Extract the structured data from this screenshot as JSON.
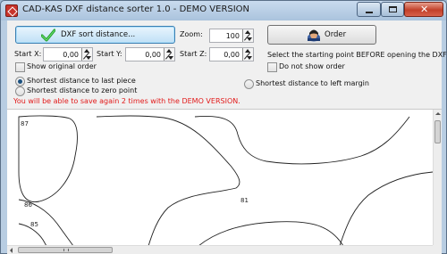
{
  "window": {
    "title": "CAD-KAS DXF distance sorter 1.0 - DEMO VERSION",
    "close_glyph": "✕"
  },
  "toolbar": {
    "sort_button_label": "DXF sort distance...",
    "zoom_label": "Zoom:",
    "zoom_value": "100",
    "order_button_label": "Order",
    "instruction_text": "Select the starting point BEFORE opening the DXF file!"
  },
  "start_fields": {
    "start_x_label": "Start X:",
    "start_x_value": "0,00",
    "start_y_label": "Start Y:",
    "start_y_value": "0,00",
    "start_z_label": "Start Z:",
    "start_z_value": "0,00"
  },
  "options": {
    "show_original_order": "Show original order",
    "do_not_show_order": "Do not show order",
    "radio_last_piece": "Shortest distance to last piece",
    "radio_zero_point": "Shortest distance to zero point",
    "radio_left_margin": "Shortest distance to left margin",
    "selected_radio": "Shortest distance to last piece"
  },
  "demo_note": "You will be able to save again 2 times with the DEMO VERSION.",
  "drawing": {
    "piece_labels": [
      "87",
      "86",
      "85",
      "81"
    ]
  },
  "icons": {
    "app": "cad-kas-app-icon",
    "sort_button": "green-check-icon",
    "order_button": "user-icon"
  },
  "colors": {
    "title_bar": "#b8cde2",
    "warning_text": "#e21a1a",
    "sort_button_face": "#bfe0f6",
    "close_button": "#c2402a"
  }
}
